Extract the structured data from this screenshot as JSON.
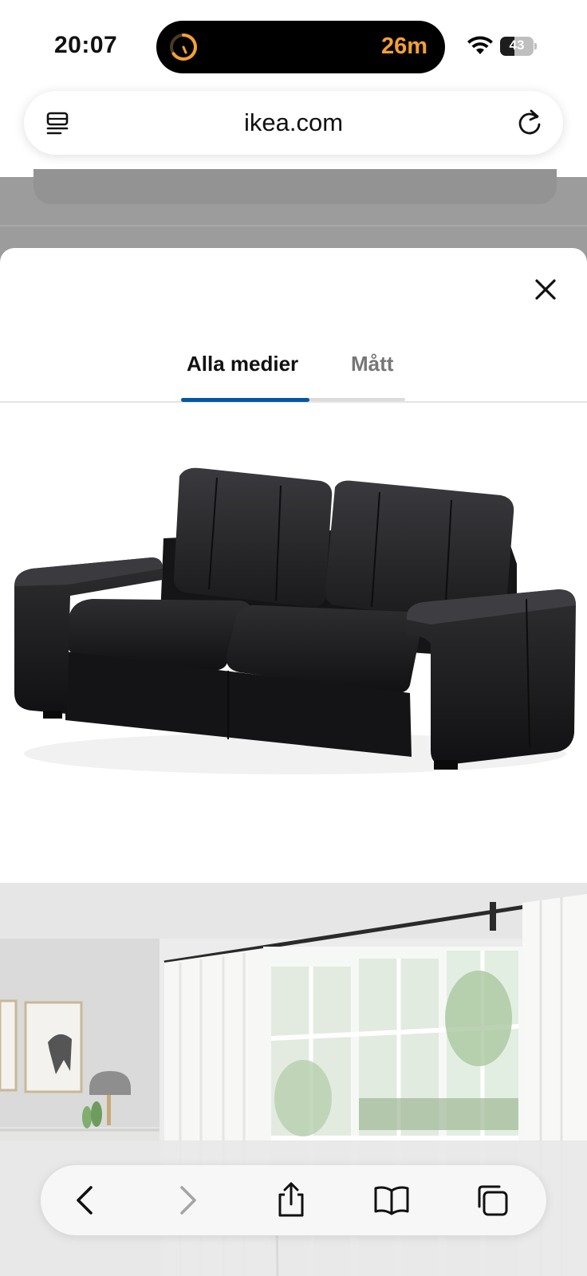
{
  "status_bar": {
    "time": "20:07",
    "live_activity_timer": "26m",
    "battery_level": "43",
    "accent_color": "#f5a030"
  },
  "address_bar": {
    "url": "ikea.com",
    "left_icon": "reader-mode-icon",
    "right_icon": "reload-icon"
  },
  "modal": {
    "close_icon": "close-icon",
    "tabs": [
      {
        "label": "Alla medier",
        "active": true
      },
      {
        "label": "Mått",
        "active": false
      }
    ],
    "active_tab_color": "#0058a3",
    "images": [
      {
        "name": "product-image",
        "subject": "black leather two-seat sofa"
      },
      {
        "name": "room-image",
        "subject": "bright room with white curtains and large window"
      }
    ]
  },
  "bottom_toolbar": {
    "buttons": [
      {
        "name": "back-button",
        "icon": "chevron-left-icon",
        "enabled": true
      },
      {
        "name": "forward-button",
        "icon": "chevron-right-icon",
        "enabled": false
      },
      {
        "name": "share-button",
        "icon": "share-icon",
        "enabled": true
      },
      {
        "name": "bookmarks-button",
        "icon": "book-icon",
        "enabled": true
      },
      {
        "name": "tabs-button",
        "icon": "tabs-icon",
        "enabled": true
      }
    ]
  }
}
